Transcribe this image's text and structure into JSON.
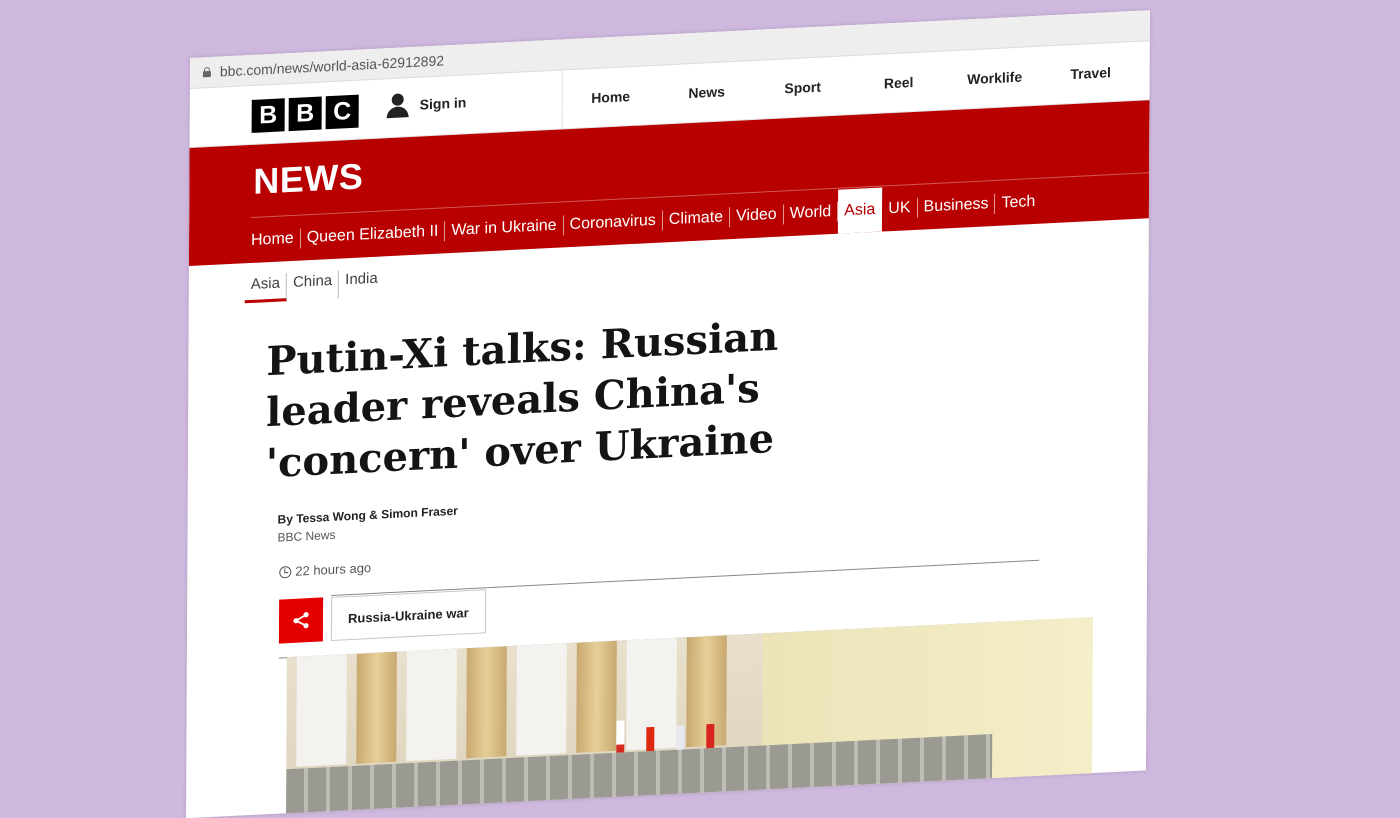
{
  "browser": {
    "url": "bbc.com/news/world-asia-62912892"
  },
  "masthead": {
    "logo_letters": [
      "B",
      "B",
      "C"
    ],
    "sign_in": "Sign in",
    "nav": [
      "Home",
      "News",
      "Sport",
      "Reel",
      "Worklife",
      "Travel"
    ]
  },
  "news": {
    "title": "NEWS",
    "nav": [
      "Home",
      "Queen Elizabeth II",
      "War in Ukraine",
      "Coronavirus",
      "Climate",
      "Video",
      "World",
      "Asia",
      "UK",
      "Business",
      "Tech"
    ],
    "active": "Asia"
  },
  "subnav": [
    "Asia",
    "China",
    "India"
  ],
  "article": {
    "headline": "Putin-Xi talks: Russian leader reveals China's 'concern' over Ukraine",
    "byline": "By Tessa Wong & Simon Fraser",
    "source": "BBC News",
    "time": "22 hours ago",
    "topic": "Russia-Ukraine war"
  },
  "colors": {
    "brand_red": "#b80000",
    "share_red": "#e50000",
    "background": "#cfb8de"
  },
  "icons": [
    "lock-icon",
    "user-icon",
    "clock-icon",
    "share-icon"
  ]
}
